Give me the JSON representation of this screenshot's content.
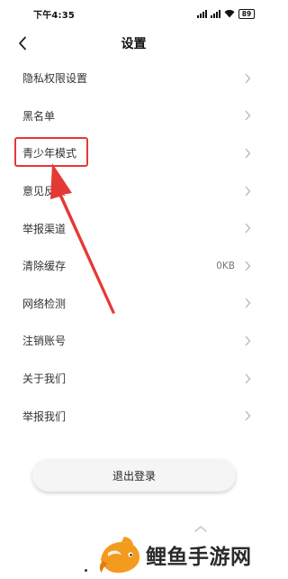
{
  "status_bar": {
    "time": "下午4:35",
    "battery": "89"
  },
  "header": {
    "title": "设置"
  },
  "menu": {
    "items": [
      {
        "label": "隐私权限设置",
        "value": ""
      },
      {
        "label": "黑名单",
        "value": ""
      },
      {
        "label": "青少年模式",
        "value": ""
      },
      {
        "label": "意见反馈",
        "value": ""
      },
      {
        "label": "举报渠道",
        "value": ""
      },
      {
        "label": "清除缓存",
        "value": "0KB"
      },
      {
        "label": "网络检测",
        "value": ""
      },
      {
        "label": "注销账号",
        "value": ""
      },
      {
        "label": "关于我们",
        "value": ""
      },
      {
        "label": "举报我们",
        "value": ""
      }
    ]
  },
  "footer": {
    "logout_label": "退出登录"
  },
  "watermark": {
    "text": "鲤鱼手游网"
  },
  "colors": {
    "highlight": "#e53935",
    "logo_orange": "#f39b1e"
  },
  "icons": [
    "back-arrow-icon",
    "chevron-right-icon",
    "wifi-icon",
    "signal-icon",
    "battery-icon",
    "chevron-up-icon",
    "fish-logo-icon"
  ]
}
